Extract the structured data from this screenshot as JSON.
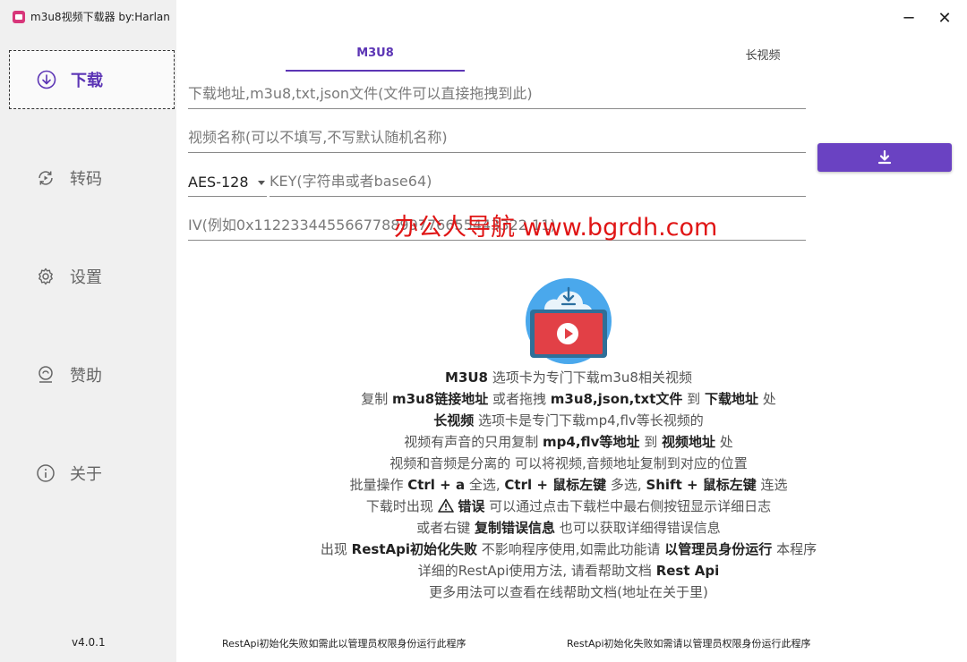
{
  "window": {
    "title": "m3u8视频下载器 by:Harlan",
    "minimize_glyph": "─",
    "close_glyph": "✕"
  },
  "sidebar": {
    "items": [
      {
        "label": "下载",
        "icon": "download-circle-icon",
        "active": true
      },
      {
        "label": "转码",
        "icon": "transcode-icon",
        "active": false
      },
      {
        "label": "设置",
        "icon": "gear-icon",
        "active": false
      },
      {
        "label": "赞助",
        "icon": "sponsor-icon",
        "active": false
      },
      {
        "label": "关于",
        "icon": "info-icon",
        "active": false
      }
    ],
    "version": "v4.0.1"
  },
  "tabs": [
    {
      "label": "M3U8",
      "active": true
    },
    {
      "label": "长视频",
      "active": false
    }
  ],
  "form": {
    "url_placeholder": "下载地址,m3u8,txt,json文件(文件可以直接拖拽到此)",
    "name_placeholder": "视频名称(可以不填写,不写默认随机名称)",
    "encryption": "AES-128",
    "key_placeholder": "KEY(字符串或者base64)",
    "iv_placeholder": "IV(例如0x112233445566778899776655443322 11)"
  },
  "download_button": {
    "icon": "download-arrow-icon"
  },
  "watermark": "办公人导航 www.bgrdh.com",
  "help": {
    "l1": {
      "b1": "M3U8",
      "t1": " 选项卡为专门下载m3u8相关视频"
    },
    "l2": {
      "t1": "复制 ",
      "b1": "m3u8链接地址",
      "t2": " 或者拖拽 ",
      "b2": "m3u8,json,txt文件",
      "t3": " 到 ",
      "b3": "下载地址",
      "t4": " 处"
    },
    "l3": {
      "b1": "长视频",
      "t1": " 选项卡是专门下载mp4,flv等长视频的"
    },
    "l4": {
      "t1": "视频有声音的只用复制 ",
      "b1": "mp4,flv等地址",
      "t2": " 到 ",
      "b2": "视频地址",
      "t3": " 处"
    },
    "l5": {
      "t1": "视频和音频是分离的 可以将视频,音频地址复制到对应的位置"
    },
    "l6": {
      "t1": "批量操作 ",
      "b1": "Ctrl + a",
      "t2": " 全选, ",
      "b2": "Ctrl + 鼠标左键",
      "t3": " 多选, ",
      "b3": "Shift + 鼠标左键",
      "t4": " 连选"
    },
    "l7": {
      "t1": "下载时出现 ",
      "b1": "错误",
      "t2": " 可以通过点击下载栏中最右侧按钮显示详细日志"
    },
    "l8": {
      "t1": "或者右键 ",
      "b1": "复制错误信息",
      "t2": " 也可以获取详细得错误信息"
    },
    "l9": {
      "t1": "出现 ",
      "b1": "RestApi初始化失败",
      "t2": " 不影响程序使用,如需此功能请 ",
      "b2": "以管理员身份运行",
      "t3": " 本程序"
    },
    "l10": {
      "t1": "详细的RestApi使用方法, 请看帮助文档 ",
      "b1": "Rest Api"
    },
    "l11": {
      "t1": "更多用法可以查看在线帮助文档(地址在关于里)"
    }
  },
  "status": {
    "left": "RestApi初始化失败如需此以管理员权限身份运行此程序",
    "right": "RestApi初始化失败如需请以管理员权限身份运行此程序"
  },
  "colors": {
    "accent": "#6a42c2",
    "sidebar_bg": "#f0f0f0",
    "watermark": "#e01515"
  }
}
